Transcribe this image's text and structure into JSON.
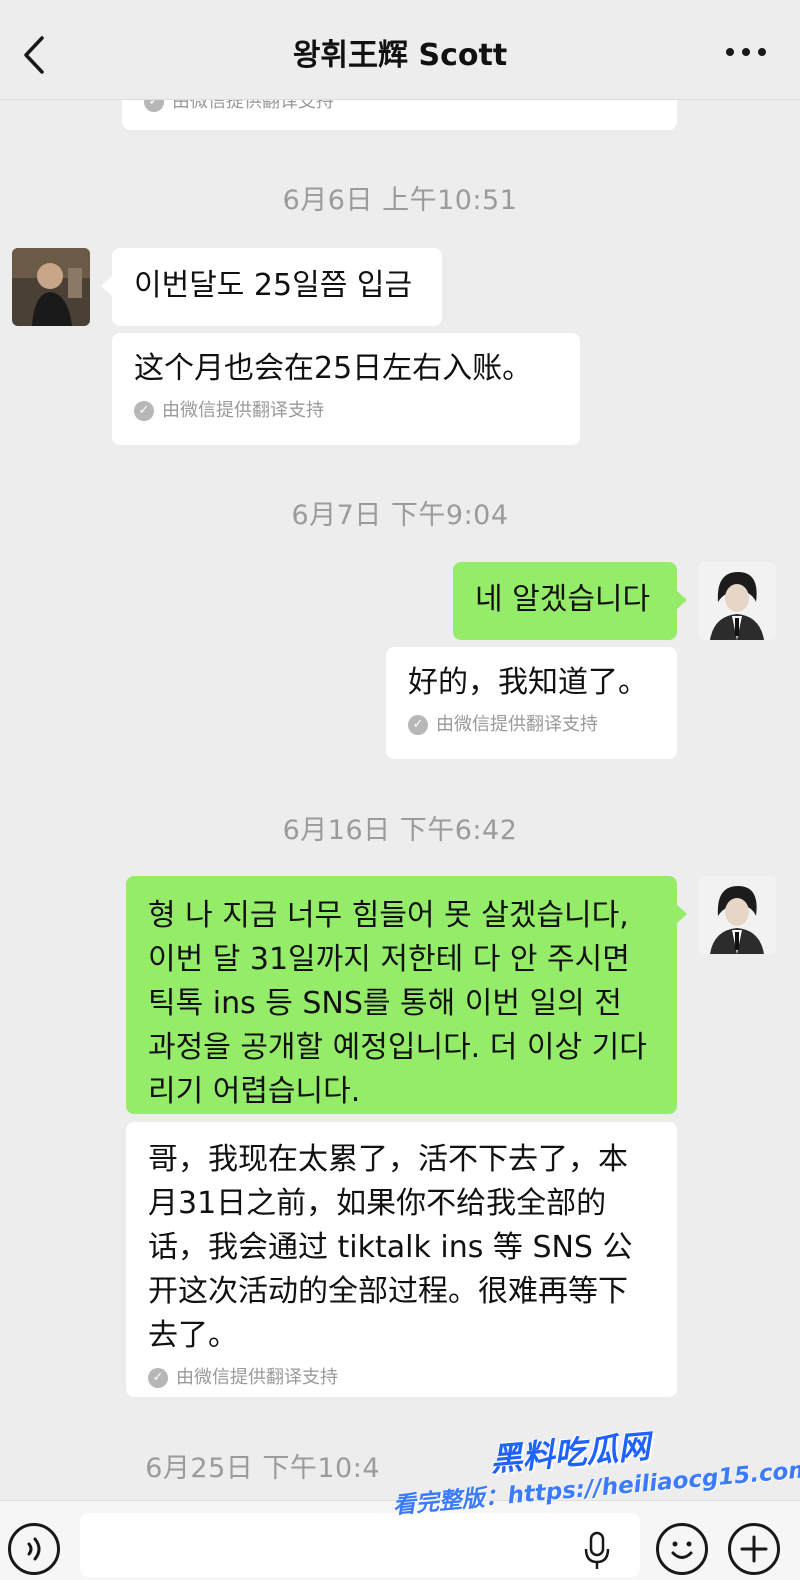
{
  "header": {
    "title": "왕휘王辉 Scott"
  },
  "icons": {
    "back": "chevron-left-icon",
    "more": "more-dots-icon",
    "voice": "voice-icon",
    "mic": "microphone-icon",
    "emoji": "emoji-icon",
    "plus": "plus-icon",
    "check": "check-icon"
  },
  "colors": {
    "background": "#ededed",
    "sent_bubble": "#95ec69",
    "received_bubble": "#ffffff",
    "timestamp_text": "#9b9b9b"
  },
  "translation_note": "由微信提供翻译支持",
  "timestamps": [
    "6月6日 上午10:51",
    "6月7日 下午9:04",
    "6月16日 下午6:42",
    "6月25日 下午10:4"
  ],
  "messages": [
    {
      "sender": "contact",
      "text": "이번달도 25일쯤 입금",
      "translation": "这个月也会在25日左右入账。"
    },
    {
      "sender": "me",
      "text": "네 알겠습니다",
      "translation": "好的，我知道了。"
    },
    {
      "sender": "me",
      "text": "형 나  지금 너무 힘들어 못 살겠습니다, 이번 달 31일까지 저한테 다 안 주시면 틱톡  ins 등 SNS를 통해 이번 일의 전 과정을 공개할 예정입니다. 더 이상 기다리기 어렵습니다.",
      "translation": "哥，我现在太累了，活不下去了，本月31日之前，如果你不给我全部的话，我会通过 tiktalk ins 等 SNS 公开这次活动的全部过程。很难再等下去了。"
    }
  ],
  "watermark": {
    "logo": "黑料吃瓜网",
    "url": "看完整版：https://heiliaocg15.com"
  }
}
